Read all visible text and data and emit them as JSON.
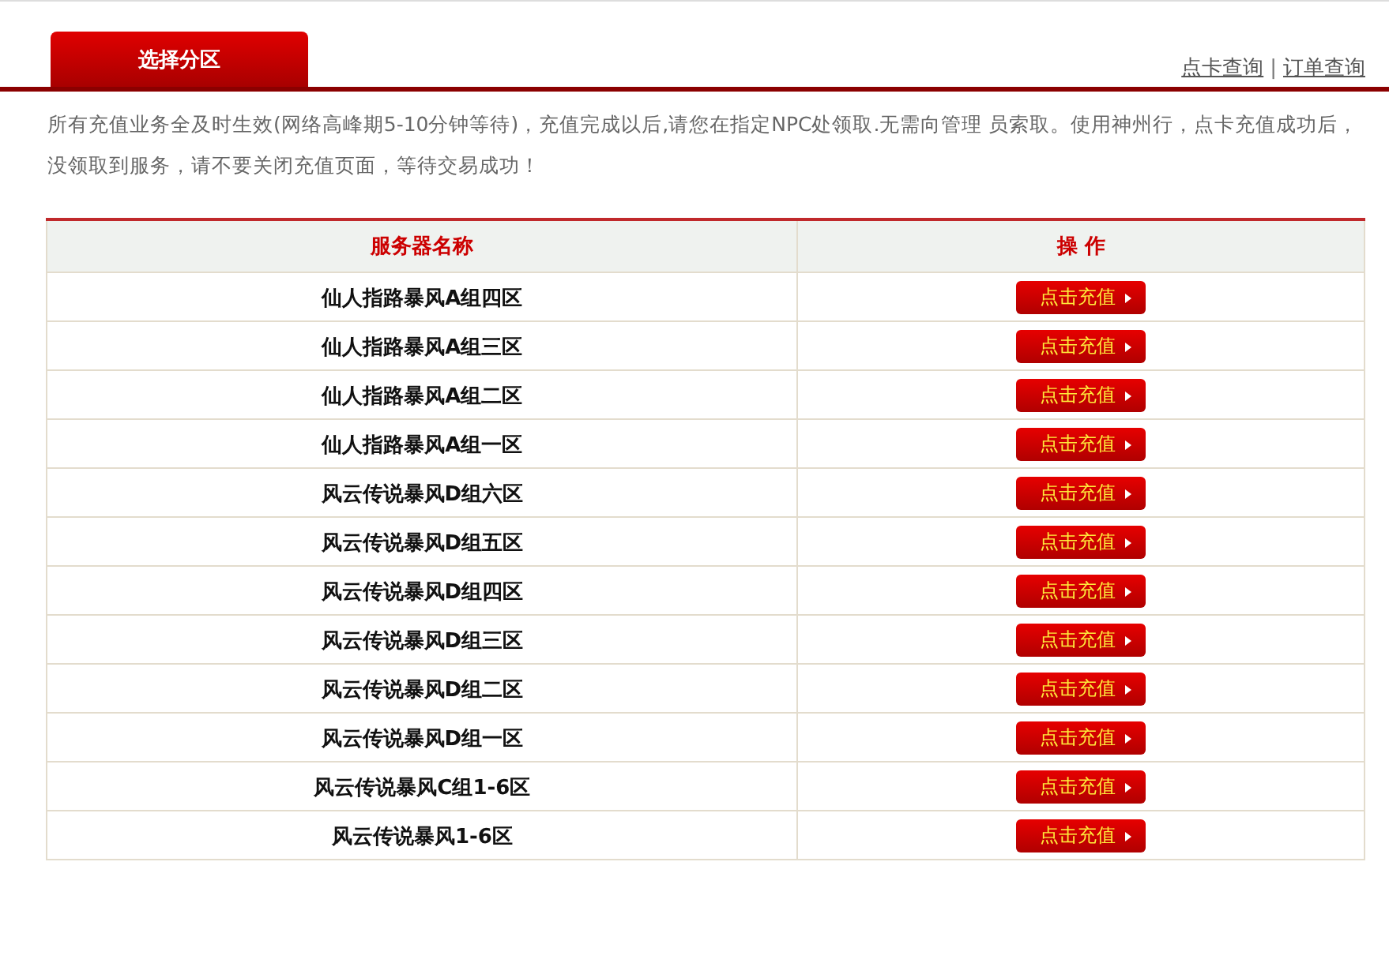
{
  "tab": {
    "label": "选择分区",
    "selected": true
  },
  "links": [
    "点卡查询",
    "订单查询"
  ],
  "link_separator": "|",
  "notice": "所有充值业务全及时生效(网络高峰期5-10分钟等待)，充值完成以后,请您在指定NPC处领取.无需向管理 员索取。使用神州行，点卡充值成功后，没领取到服务，请不要关闭充值页面，等待交易成功！",
  "table": {
    "columns": [
      "服务器名称",
      "操 作"
    ],
    "rows": [
      {
        "server": "仙人指路暴风A组四区",
        "action": "点击充值"
      },
      {
        "server": "仙人指路暴风A组三区",
        "action": "点击充值"
      },
      {
        "server": "仙人指路暴风A组二区",
        "action": "点击充值"
      },
      {
        "server": "仙人指路暴风A组一区",
        "action": "点击充值"
      },
      {
        "server": "风云传说暴风D组六区",
        "action": "点击充值"
      },
      {
        "server": "风云传说暴风D组五区",
        "action": "点击充值"
      },
      {
        "server": "风云传说暴风D组四区",
        "action": "点击充值"
      },
      {
        "server": "风云传说暴风D组三区",
        "action": "点击充值"
      },
      {
        "server": "风云传说暴风D组二区",
        "action": "点击充值"
      },
      {
        "server": "风云传说暴风D组一区",
        "action": "点击充值"
      },
      {
        "server": "风云传说暴风C组1-6区",
        "action": "点击充值"
      },
      {
        "server": "风云传说暴风1-6区",
        "action": "点击充值"
      }
    ]
  }
}
